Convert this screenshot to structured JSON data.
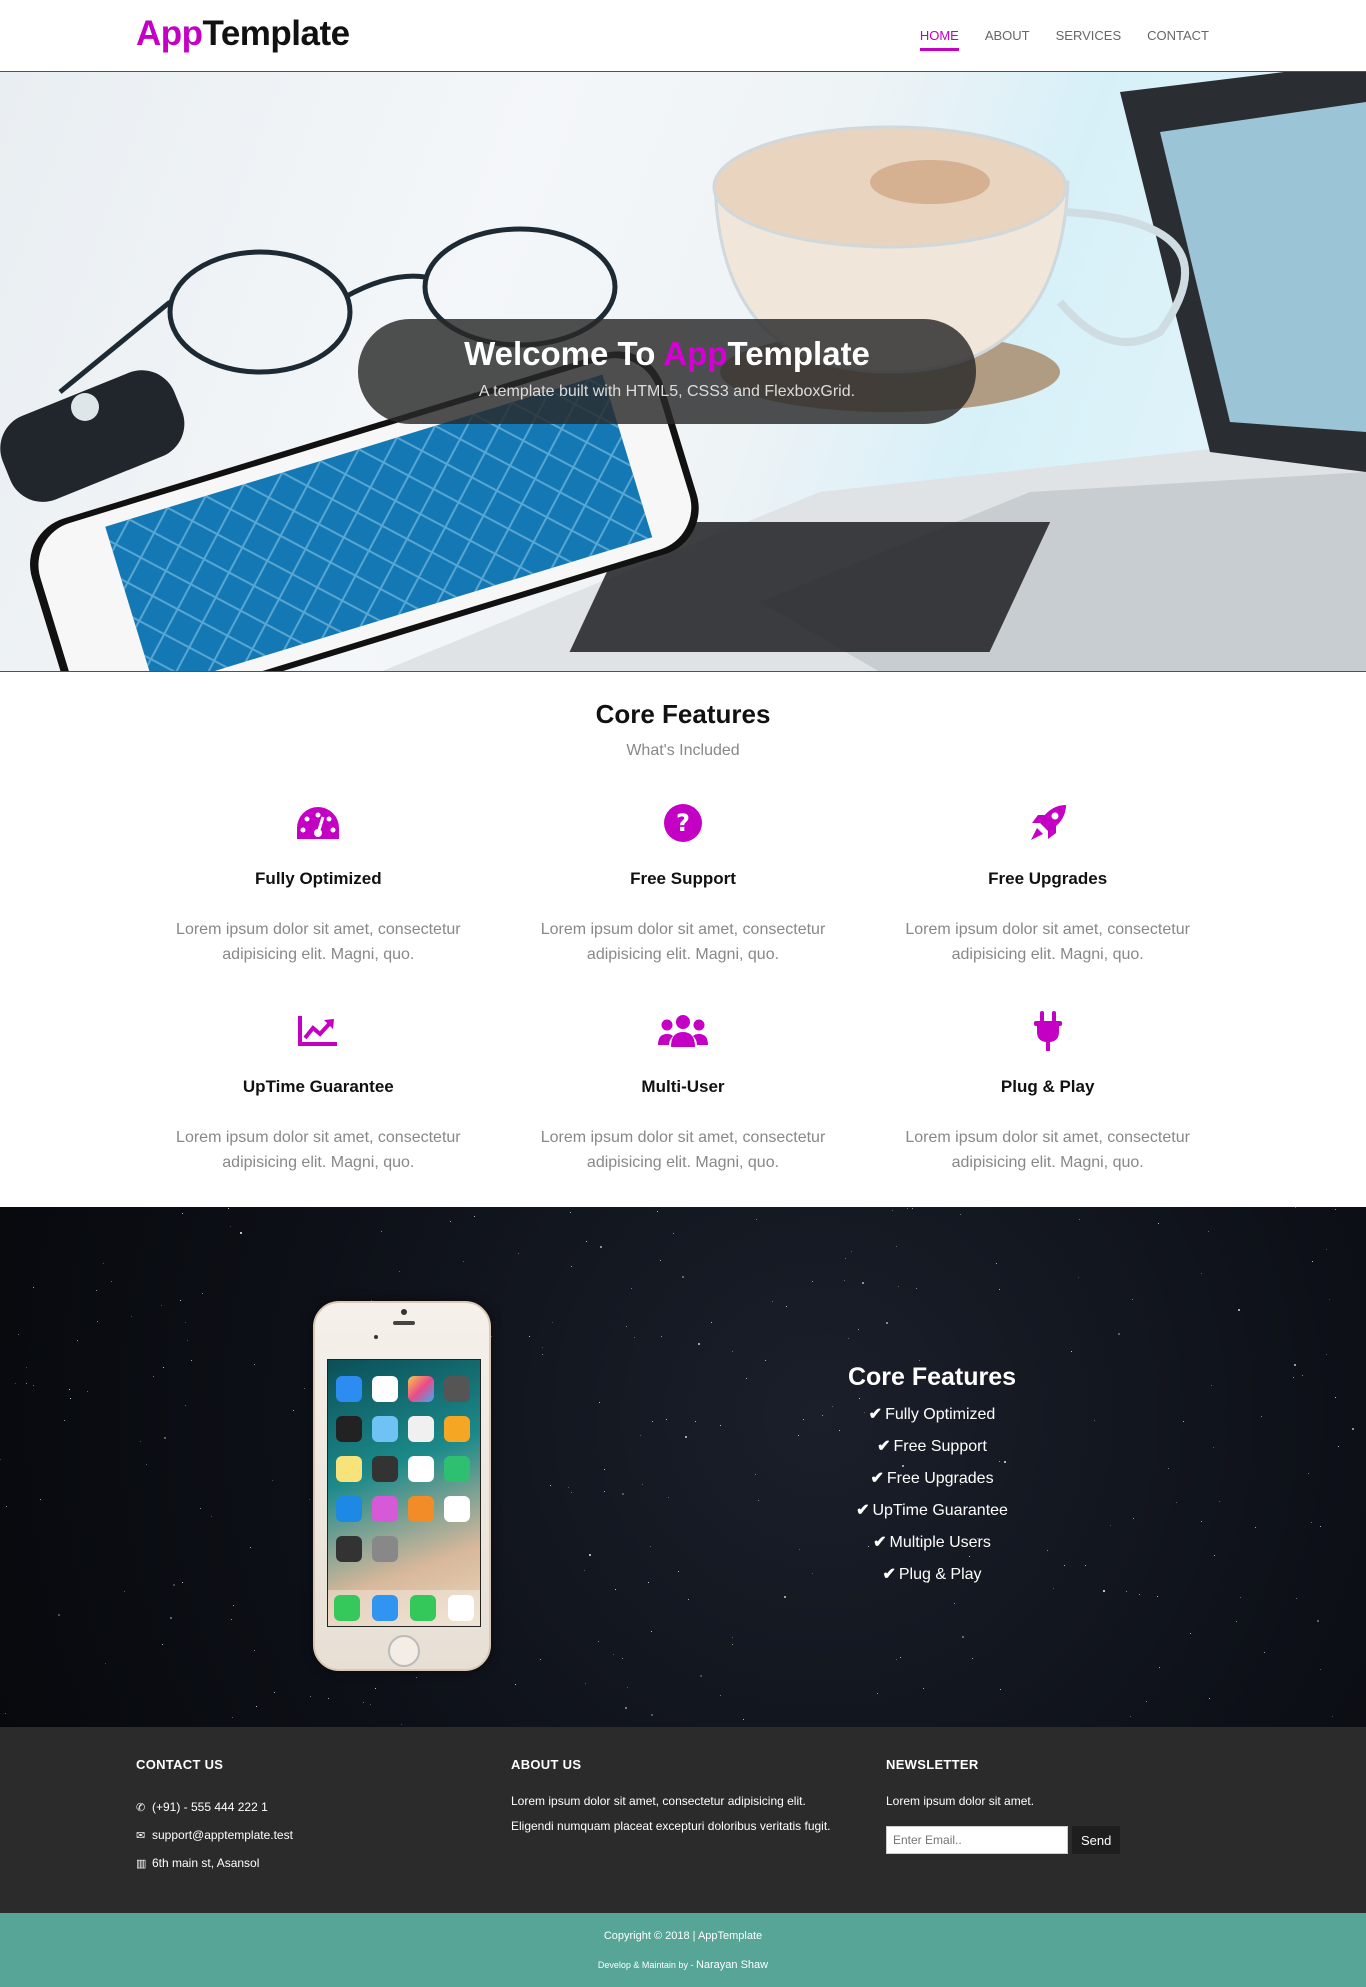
{
  "brand": {
    "accent": "App",
    "rest": "Template"
  },
  "nav": [
    {
      "label": "HOME",
      "active": true
    },
    {
      "label": "ABOUT",
      "active": false
    },
    {
      "label": "SERVICES",
      "active": false
    },
    {
      "label": "CONTACT",
      "active": false
    }
  ],
  "hero": {
    "title_prefix": "Welcome To ",
    "title_accent": "App",
    "title_rest": "Template",
    "subtitle": "A template built with HTML5, CSS3 and FlexboxGrid."
  },
  "features": {
    "title": "Core Features",
    "subtitle": "What's Included",
    "items": [
      {
        "icon": "speedometer-icon",
        "name": "Fully Optimized",
        "desc": "Lorem ipsum dolor sit amet, consectetur adipisicing elit. Magni, quo."
      },
      {
        "icon": "question-circle-icon",
        "name": "Free Support",
        "desc": "Lorem ipsum dolor sit amet, consectetur adipisicing elit. Magni, quo."
      },
      {
        "icon": "rocket-icon",
        "name": "Free Upgrades",
        "desc": "Lorem ipsum dolor sit amet, consectetur adipisicing elit. Magni, quo."
      },
      {
        "icon": "chart-line-icon",
        "name": "UpTime Guarantee",
        "desc": "Lorem ipsum dolor sit amet, consectetur adipisicing elit. Magni, quo."
      },
      {
        "icon": "users-icon",
        "name": "Multi-User",
        "desc": "Lorem ipsum dolor sit amet, consectetur adipisicing elit. Magni, quo."
      },
      {
        "icon": "plug-icon",
        "name": "Plug & Play",
        "desc": "Lorem ipsum dolor sit amet, consectetur adipisicing elit. Magni, quo."
      }
    ]
  },
  "showcase": {
    "title": "Core Features",
    "items": [
      "Fully Optimized",
      "Free Support",
      "Free Upgrades",
      "UpTime Guarantee",
      "Multiple Users",
      "Plug & Play"
    ]
  },
  "footer": {
    "contact": {
      "title": "CONTACT US",
      "phone": "(+91) - 555 444 222 1",
      "email": "support@apptemplate.test",
      "address": "6th main st, Asansol"
    },
    "about": {
      "title": "ABOUT US",
      "text": "Lorem ipsum dolor sit amet, consectetur adipisicing elit. Eligendi numquam placeat excepturi doloribus veritatis fugit."
    },
    "newsletter": {
      "title": "NEWSLETTER",
      "text": "Lorem ipsum dolor sit amet.",
      "placeholder": "Enter Email..",
      "button": "Send"
    }
  },
  "bottom": {
    "copyright": "Copyright © 2018 | AppTemplate",
    "credit_prefix": "Develop & Maintain by - ",
    "author": "Narayan Shaw"
  },
  "colors": {
    "accent": "#c400c4",
    "footer_bg": "#2b2b2b",
    "bottom_bg": "#56a597"
  }
}
